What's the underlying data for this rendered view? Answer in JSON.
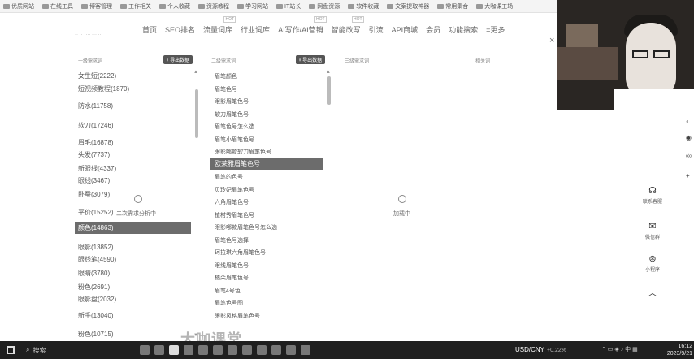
{
  "bookmarks": [
    "优质网站",
    "在线工具",
    "博客管理",
    "工作相关",
    "个人收藏",
    "资源教程",
    "学习网站",
    "IT站长",
    "网盘资源",
    "软件收藏",
    "文案提取神器",
    "常用集合",
    "大咖课工场"
  ],
  "nav": {
    "items": [
      {
        "label": "首页",
        "badge": ""
      },
      {
        "label": "SEO排名",
        "badge": ""
      },
      {
        "label": "流量词库",
        "badge": "HOT"
      },
      {
        "label": "行业词库",
        "badge": ""
      },
      {
        "label": "AI写作/AI营销",
        "badge": "HOT"
      },
      {
        "label": "智能改写",
        "badge": "HOT"
      },
      {
        "label": "引流",
        "badge": ""
      },
      {
        "label": "API商城",
        "badge": ""
      },
      {
        "label": "会员",
        "badge": ""
      },
      {
        "label": "功能搜索",
        "badge": ""
      },
      {
        "label": "=更多",
        "badge": ""
      }
    ],
    "close": "×"
  },
  "columns": {
    "col1_header": "一级需求词",
    "col2_header": "二级需求词",
    "col3_header": "三级需求词",
    "col4_header": "相关词",
    "download_label": "导出数据"
  },
  "col1_items": [
    {
      "label": "女生短(2222)",
      "selected": false
    },
    {
      "label": "短视频教程(1870)",
      "selected": false
    },
    {
      "label": "防水(11758)",
      "selected": false
    },
    {
      "label": "软刀(17246)",
      "selected": false
    },
    {
      "label": "眉毛(16878)",
      "selected": false
    },
    {
      "label": "头发(7737)",
      "selected": false
    },
    {
      "label": "新眼线(4337)",
      "selected": false
    },
    {
      "label": "眼线(3467)",
      "selected": false
    },
    {
      "label": "卧蚕(3079)",
      "selected": false
    },
    {
      "label": "平价(15252)",
      "selected": false
    },
    {
      "label": "颜色(14863)",
      "selected": true
    },
    {
      "label": "眼影(13852)",
      "selected": false
    },
    {
      "label": "眼线笔(4590)",
      "selected": false
    },
    {
      "label": "眼睛(3780)",
      "selected": false
    },
    {
      "label": "粉色(2691)",
      "selected": false
    },
    {
      "label": "眼影盘(2032)",
      "selected": false
    },
    {
      "label": "新手(13040)",
      "selected": false
    },
    {
      "label": "粉色(10715)",
      "selected": false
    }
  ],
  "col2_items": [
    {
      "label": "眉笔颜色",
      "selected": false
    },
    {
      "label": "眉笔色号",
      "selected": false
    },
    {
      "label": "眼影眉笔色号",
      "selected": false
    },
    {
      "label": "软刀眉笔色号",
      "selected": false
    },
    {
      "label": "眉笔色号怎么选",
      "selected": false
    },
    {
      "label": "眉笔小眉笔色号",
      "selected": false
    },
    {
      "label": "眼影哪款软刀眉笔色号",
      "selected": false
    },
    {
      "label": "欧莱雅眉笔色号",
      "selected": true
    },
    {
      "label": "眉笔的色号",
      "selected": false
    },
    {
      "label": "贝玲妃眉笔色号",
      "selected": false
    },
    {
      "label": "六角眉笔色号",
      "selected": false
    },
    {
      "label": "植村秀眉笔色号",
      "selected": false
    },
    {
      "label": "眼影哪款眉笔色号怎么选",
      "selected": false
    },
    {
      "label": "眉笔色号选择",
      "selected": false
    },
    {
      "label": "珂拉琪六角眉笔色号",
      "selected": false
    },
    {
      "label": "眼线眉笔色号",
      "selected": false
    },
    {
      "label": "橘朵眉笔色号",
      "selected": false
    },
    {
      "label": "眉笔4号色",
      "selected": false
    },
    {
      "label": "眉笔色号图",
      "selected": false
    },
    {
      "label": "眼影风格眉笔色号",
      "selected": false
    }
  ],
  "loading": {
    "col2": "二次需求分析中",
    "col3": "加载中"
  },
  "sidebar": {
    "service": "联系客服",
    "chat": "微信群",
    "miniapp": "小程序"
  },
  "taskbar": {
    "search": "搜索",
    "ticker_pair": "USD/CNY",
    "ticker_change": "+0.22%",
    "time": "16:12",
    "date": "2023/9/21"
  },
  "watermark": "大咖课堂"
}
